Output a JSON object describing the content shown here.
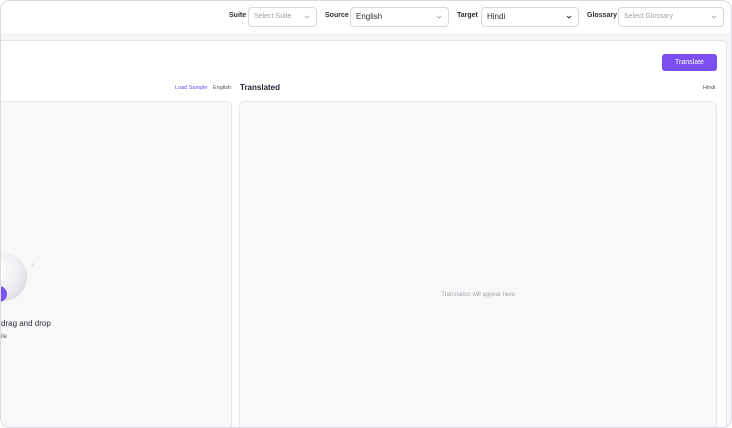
{
  "toolbar": {
    "suite_label": "Suite",
    "suite_placeholder": "Select Suite",
    "source_label": "Source",
    "source_value": "English",
    "target_label": "Target",
    "target_value": "Hindi",
    "glossary_label": "Glossary",
    "glossary_placeholder": "Select Glossary"
  },
  "actions": {
    "translate_label": "Translate"
  },
  "source_pane": {
    "load_sample_label": "Load Sample",
    "language": "English",
    "drag_text": "drag and drop",
    "file_text": "ile"
  },
  "target_pane": {
    "title": "Translated",
    "language": "Hindi",
    "placeholder": "Translation will appear here"
  },
  "colors": {
    "accent": "#7b4ff0",
    "link": "#6d4bf0"
  }
}
